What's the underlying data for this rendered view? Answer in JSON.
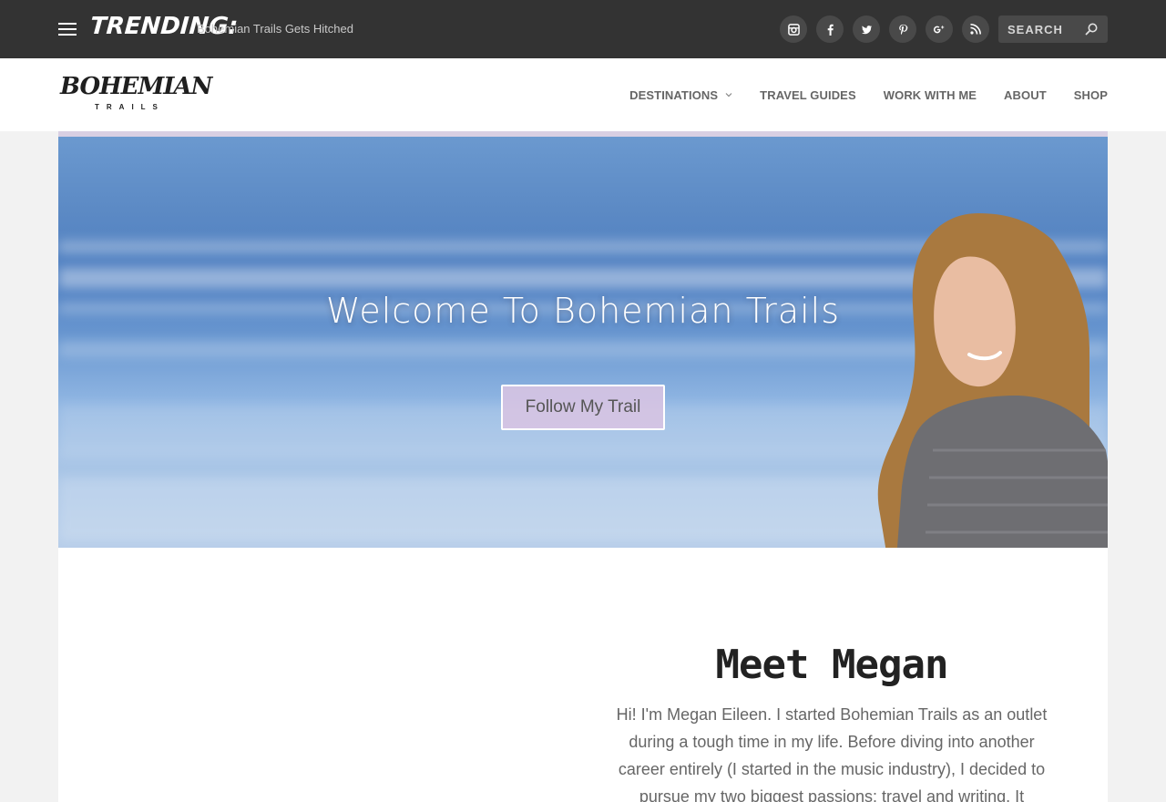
{
  "topbar": {
    "trending_label": "TRENDING:",
    "trending_link": "Bohemian Trails Gets Hitched",
    "socials": [
      {
        "icon": "instagram-icon"
      },
      {
        "icon": "facebook-icon"
      },
      {
        "icon": "twitter-icon"
      },
      {
        "icon": "pinterest-icon"
      },
      {
        "icon": "google-plus-icon"
      },
      {
        "icon": "rss-icon"
      }
    ],
    "search_placeholder": "SEARCH"
  },
  "header": {
    "logo_main": "BOHEMIAN",
    "logo_sub": "TRAILS",
    "nav": [
      {
        "label": "DESTINATIONS",
        "has_dropdown": true
      },
      {
        "label": "TRAVEL GUIDES"
      },
      {
        "label": "WORK WITH ME"
      },
      {
        "label": "ABOUT"
      },
      {
        "label": "SHOP"
      }
    ]
  },
  "hero": {
    "title": "Welcome To Bohemian Trails",
    "button_label": "Follow My Trail"
  },
  "about": {
    "title": "Meet Megan",
    "text": "Hi! I'm Megan Eileen. I started Bohemian Trails as an outlet during a tough time in my life. Before diving into another career entirely (I started in the music industry), I decided to pursue my two biggest passions: travel and writing. It wasn't"
  },
  "colors": {
    "topbar_bg": "#333333",
    "header_bg": "#ffffff",
    "page_bg": "#f2f2f2",
    "button_bg": "#d8c4e2",
    "hero_sea": "#4f7fc1"
  }
}
